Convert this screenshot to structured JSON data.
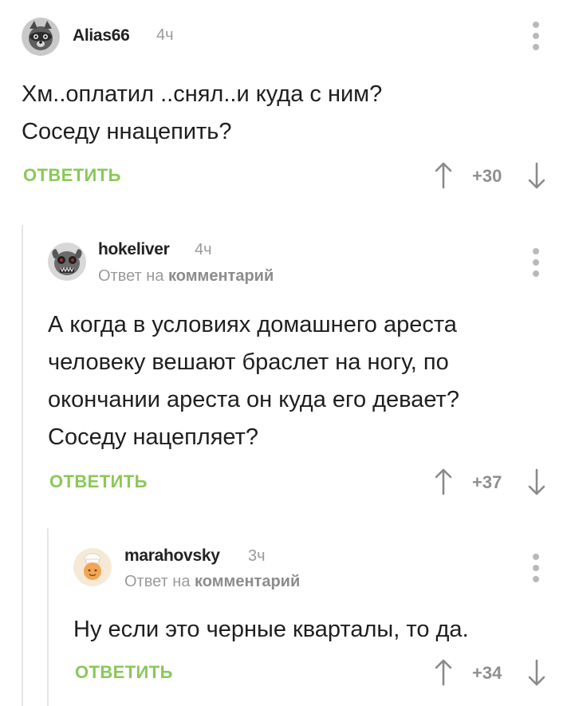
{
  "comments": [
    {
      "username": "Alias66",
      "time": "4ч",
      "text_lines": [
        "Хм..оплатил ..снял..и куда с ним?",
        "Соседу ннацепить?"
      ],
      "reply_label": "ОТВЕТИТЬ",
      "rating": "+30",
      "avatar_icon": "raccoon-avatar"
    },
    {
      "username": "hokeliver",
      "time": "4ч",
      "reply_prefix": "Ответ на",
      "reply_target": "комментарий",
      "text_lines": [
        "А когда в условиях домашнего ареста",
        "человеку вешают браслет на ногу, по",
        "окончании ареста он куда его девает?",
        "Соседу нацепляет?"
      ],
      "reply_label": "ОТВЕТИТЬ",
      "rating": "+37",
      "avatar_icon": "creature-avatar"
    },
    {
      "username": "marahovsky",
      "time": "3ч",
      "reply_prefix": "Ответ на",
      "reply_target": "комментарий",
      "text_lines": [
        "Ну если это черные кварталы, то да."
      ],
      "reply_label": "ОТВЕТИТЬ",
      "rating": "+34",
      "avatar_icon": "chef-avatar"
    }
  ],
  "colors": {
    "reply_green": "#8ac858",
    "meta_gray": "#9a9a9a",
    "thread_line": "#e6e6e6"
  }
}
